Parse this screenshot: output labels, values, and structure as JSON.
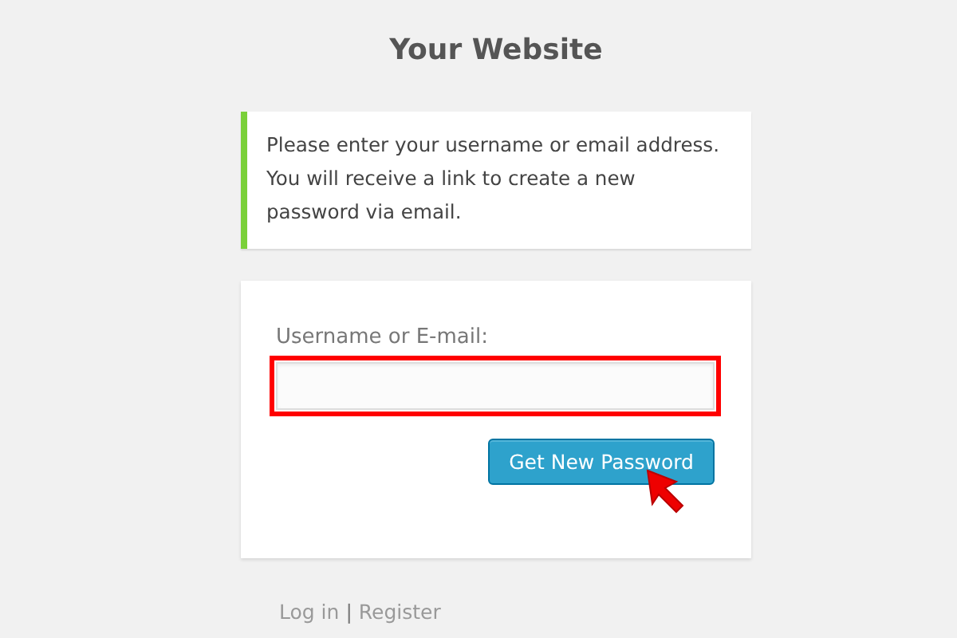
{
  "site_title": "Your Website",
  "message": "Please enter your username or email address. You will receive a link to create a new password via email.",
  "form": {
    "label": "Username or E-mail:",
    "highlighted": true,
    "button": "Get New Password"
  },
  "nav": [
    {
      "kind": "link",
      "text": "Log in"
    },
    {
      "kind": "separator",
      "text": "|"
    },
    {
      "kind": "link",
      "text": "Register"
    }
  ]
}
